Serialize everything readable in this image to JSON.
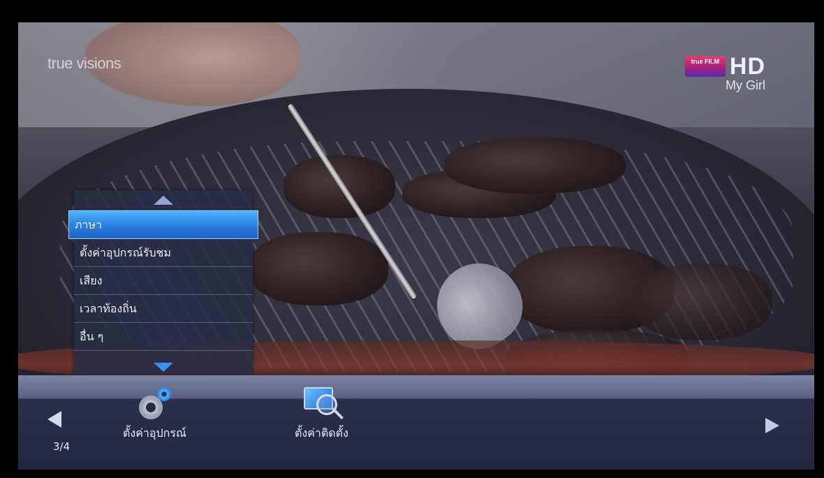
{
  "overlay": {
    "provider_logo": "true visions",
    "channel_badge": "true FILM",
    "channel_hd": "HD",
    "program_name": "My Girl"
  },
  "settings_menu": {
    "items": [
      {
        "label": "ภาษา",
        "selected": true
      },
      {
        "label": "ตั้งค่าอุปกรณ์รับชม",
        "selected": false
      },
      {
        "label": "เสียง",
        "selected": false
      },
      {
        "label": "เวลาท้องถิ่น",
        "selected": false
      },
      {
        "label": "อื่น ๆ",
        "selected": false
      }
    ]
  },
  "bottom_bar": {
    "page_indicator": "3/4",
    "tiles": [
      {
        "label": "ตั้งค่าอุปกรณ์",
        "icon": "gear-icon"
      },
      {
        "label": "ตั้งค่าติดตั้ง",
        "icon": "install-search-icon"
      }
    ]
  },
  "colors": {
    "selected_item": "#2a7de0",
    "menu_bg": "#282c46",
    "bar_bg": "#222640"
  }
}
